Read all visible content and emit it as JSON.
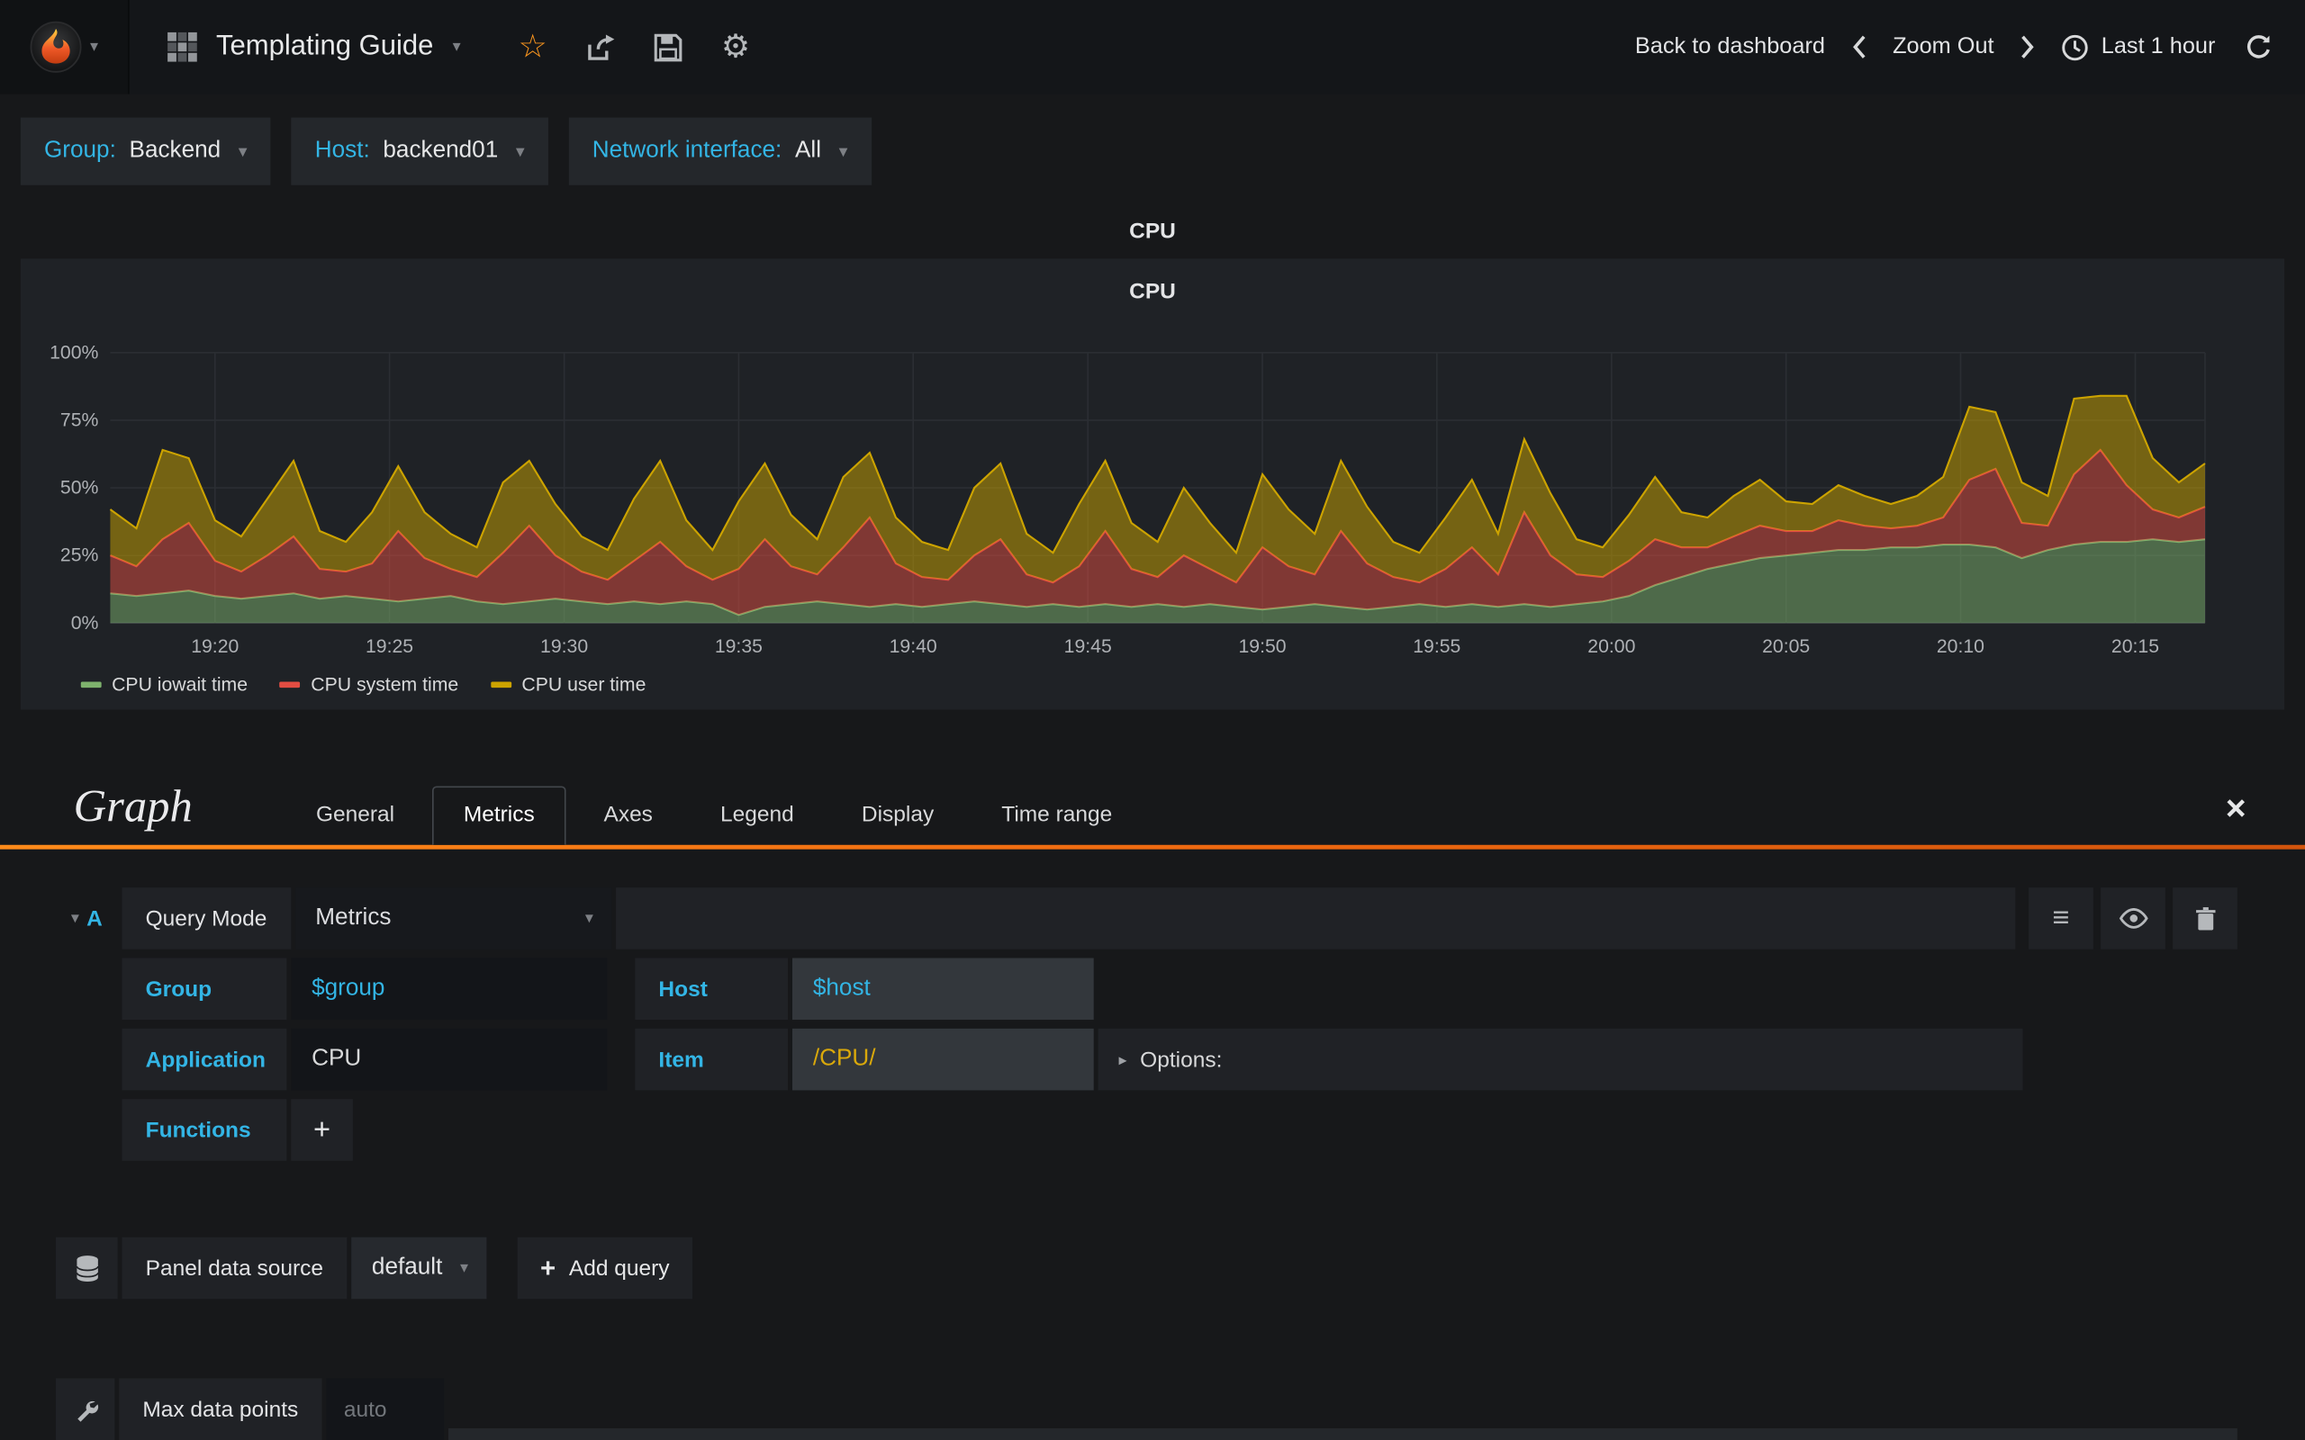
{
  "colors": {
    "accent_blue": "#33b5e5",
    "accent_orange": "#ee670f",
    "star_yellow": "#f7941e",
    "item_regex_gold": "#d9a80b",
    "panel_bg": "#1f2226",
    "page_bg": "#17181a"
  },
  "icons": {
    "caret_down": "▾",
    "caret_right": "▸",
    "hamburger": "≡",
    "gear": "⚙",
    "star": "☆",
    "plus": "+",
    "close": "×"
  },
  "navbar": {
    "dashboard_title": "Templating Guide",
    "back_label": "Back to dashboard",
    "zoom_out_label": "Zoom Out",
    "time_range_label": "Last 1 hour"
  },
  "variables": [
    {
      "label": "Group:",
      "value": "Backend"
    },
    {
      "label": "Host:",
      "value": "backend01"
    },
    {
      "label": "Network interface:",
      "value": "All"
    }
  ],
  "panel": {
    "title": "CPU",
    "chart_title": "CPU"
  },
  "chart_data": {
    "type": "area",
    "stacked": true,
    "title": "CPU",
    "unit": "percent",
    "ylim": [
      0,
      100
    ],
    "y_ticks": [
      0,
      25,
      50,
      75,
      100
    ],
    "x_start": "19:17",
    "x_end": "20:17",
    "grid": true,
    "legend_position": "bottom-left",
    "x_ticks": [
      {
        "label": "19:20",
        "frac": 0.05
      },
      {
        "label": "19:25",
        "frac": 0.1333
      },
      {
        "label": "19:30",
        "frac": 0.2167
      },
      {
        "label": "19:35",
        "frac": 0.3
      },
      {
        "label": "19:40",
        "frac": 0.3833
      },
      {
        "label": "19:45",
        "frac": 0.4667
      },
      {
        "label": "19:50",
        "frac": 0.55
      },
      {
        "label": "19:55",
        "frac": 0.6333
      },
      {
        "label": "20:00",
        "frac": 0.7167
      },
      {
        "label": "20:05",
        "frac": 0.8
      },
      {
        "label": "20:10",
        "frac": 0.8833
      },
      {
        "label": "20:15",
        "frac": 0.9667
      }
    ],
    "series": [
      {
        "name": "CPU iowait time",
        "color": "#7eb26d",
        "values": [
          11,
          10,
          11,
          12,
          10,
          9,
          10,
          11,
          9,
          10,
          9,
          8,
          9,
          10,
          8,
          7,
          8,
          9,
          8,
          7,
          8,
          7,
          8,
          7,
          3,
          6,
          7,
          8,
          7,
          6,
          7,
          6,
          7,
          8,
          7,
          6,
          7,
          6,
          7,
          6,
          7,
          6,
          7,
          6,
          5,
          6,
          7,
          6,
          5,
          6,
          7,
          6,
          7,
          6,
          7,
          6,
          7,
          8,
          10,
          14,
          17,
          20,
          22,
          24,
          25,
          26,
          27,
          27,
          28,
          28,
          29,
          29,
          28,
          24,
          27,
          29,
          30,
          30,
          31,
          30,
          31
        ]
      },
      {
        "name": "CPU system time",
        "color": "#e24d42",
        "values": [
          14,
          11,
          20,
          25,
          13,
          10,
          15,
          21,
          11,
          9,
          13,
          26,
          15,
          10,
          9,
          19,
          28,
          16,
          11,
          9,
          15,
          23,
          13,
          9,
          17,
          25,
          14,
          10,
          21,
          33,
          15,
          11,
          9,
          17,
          24,
          12,
          8,
          15,
          27,
          14,
          10,
          19,
          13,
          9,
          23,
          15,
          11,
          28,
          17,
          11,
          8,
          14,
          21,
          12,
          34,
          19,
          11,
          9,
          13,
          17,
          11,
          8,
          10,
          12,
          9,
          8,
          11,
          9,
          7,
          8,
          10,
          24,
          29,
          13,
          9,
          26,
          34,
          21,
          11,
          9,
          12
        ]
      },
      {
        "name": "CPU user time",
        "color": "#cca300",
        "values": [
          17,
          14,
          33,
          24,
          15,
          13,
          21,
          28,
          14,
          11,
          19,
          24,
          17,
          13,
          11,
          26,
          24,
          19,
          13,
          11,
          23,
          30,
          17,
          11,
          25,
          28,
          19,
          13,
          26,
          24,
          17,
          13,
          11,
          25,
          28,
          15,
          11,
          23,
          26,
          17,
          13,
          25,
          17,
          11,
          27,
          21,
          15,
          26,
          21,
          13,
          11,
          19,
          25,
          15,
          27,
          23,
          13,
          11,
          17,
          23,
          13,
          11,
          15,
          17,
          11,
          10,
          13,
          11,
          9,
          11,
          15,
          27,
          21,
          15,
          11,
          28,
          20,
          33,
          19,
          13,
          16
        ]
      }
    ]
  },
  "editor": {
    "title": "Graph",
    "active_tab": "Metrics",
    "tabs": [
      {
        "label": "General"
      },
      {
        "label": "Metrics"
      },
      {
        "label": "Axes"
      },
      {
        "label": "Legend"
      },
      {
        "label": "Display"
      },
      {
        "label": "Time range"
      }
    ],
    "query": {
      "letter": "A",
      "mode_label": "Query Mode",
      "mode_value": "Metrics",
      "fields": {
        "group_label": "Group",
        "group_value": "$group",
        "host_label": "Host",
        "host_value": "$host",
        "app_label": "Application",
        "app_value": "CPU",
        "item_label": "Item",
        "item_value": "/CPU/",
        "options_label": "Options:",
        "functions_label": "Functions"
      }
    },
    "datasource": {
      "label": "Panel data source",
      "value": "default",
      "add_query_label": "Add query"
    },
    "max_data_points": {
      "label": "Max data points",
      "placeholder": "auto"
    }
  }
}
